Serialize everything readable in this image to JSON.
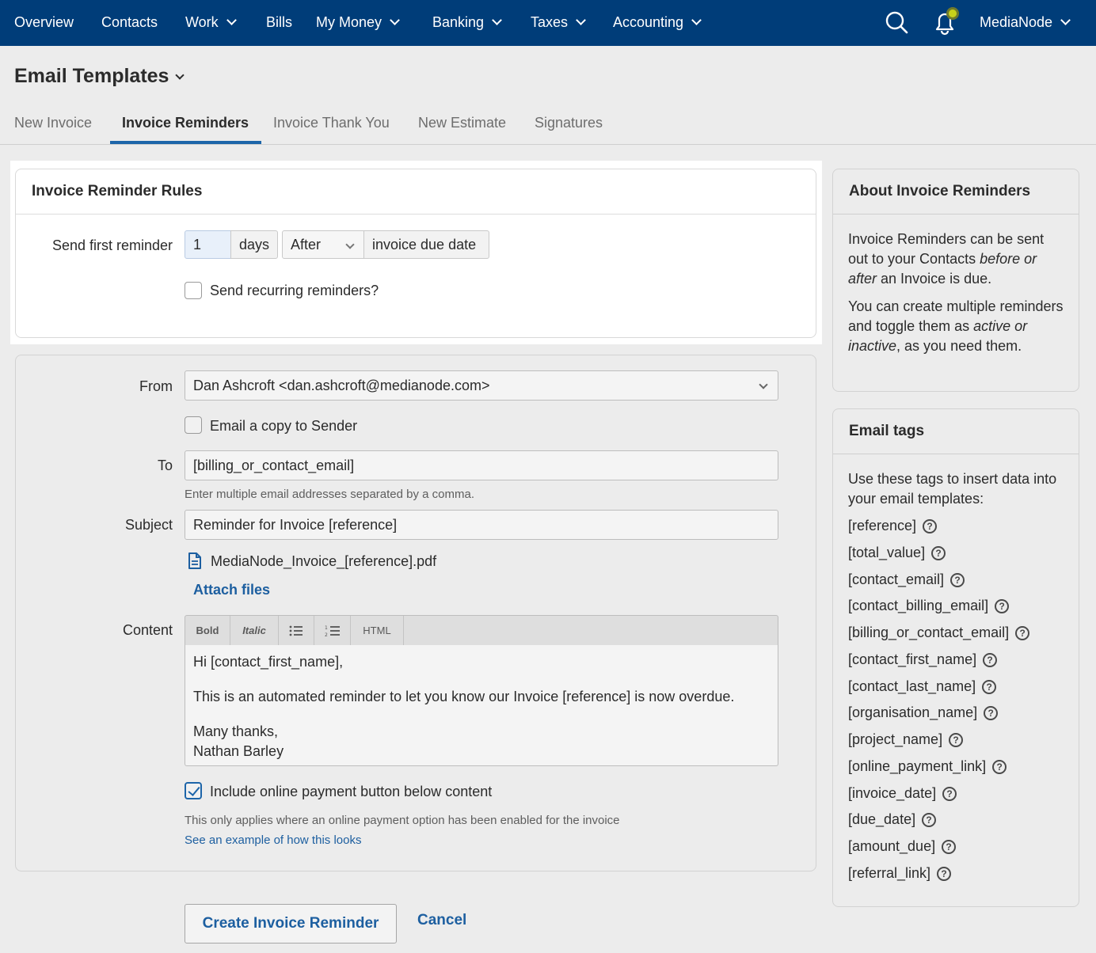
{
  "nav": {
    "items": [
      {
        "label": "Overview",
        "dropdown": false
      },
      {
        "label": "Contacts",
        "dropdown": false
      },
      {
        "label": "Work",
        "dropdown": true
      },
      {
        "label": "Bills",
        "dropdown": false
      },
      {
        "label": "My Money",
        "dropdown": true
      },
      {
        "label": "Banking",
        "dropdown": true
      },
      {
        "label": "Taxes",
        "dropdown": true
      },
      {
        "label": "Accounting",
        "dropdown": true
      }
    ],
    "account_label": "MediaNode",
    "colors": {
      "bar": "#003d79",
      "notification_dot": "#c8d21a"
    }
  },
  "page": {
    "title": "Email Templates",
    "tabs": [
      "New Invoice",
      "Invoice Reminders",
      "Invoice Thank You",
      "New Estimate",
      "Signatures"
    ],
    "active_tab": "Invoice Reminders"
  },
  "rules": {
    "header": "Invoice Reminder Rules",
    "send_first_label": "Send first reminder",
    "days_value": "1",
    "days_unit": "days",
    "timing_selected": "After",
    "suffix": "invoice due date",
    "recurring_label": "Send recurring reminders?",
    "recurring_checked": false
  },
  "email": {
    "from_label": "From",
    "from_value": "Dan Ashcroft <dan.ashcroft@medianode.com>",
    "copy_label": "Email a copy to Sender",
    "copy_checked": false,
    "to_label": "To",
    "to_value": "[billing_or_contact_email]",
    "to_hint": "Enter multiple email addresses separated by a comma.",
    "subject_label": "Subject",
    "subject_value": "Reminder for Invoice [reference]",
    "attachment_name": "MediaNode_Invoice_[reference].pdf",
    "attach_link": "Attach files",
    "content_label": "Content",
    "toolbar": {
      "bold": "Bold",
      "italic": "Italic",
      "html": "HTML"
    },
    "content": {
      "greeting": "Hi [contact_first_name],",
      "body": "This is an automated reminder to let you know our Invoice [reference] is now overdue.",
      "signoff": "Many thanks,",
      "name": "Nathan Barley"
    },
    "payment_label": "Include online payment button below content",
    "payment_checked": true,
    "payment_hint": "This only applies where an online payment option has been enabled for the invoice",
    "example_link": "See an example of how this looks"
  },
  "about": {
    "header": "About Invoice Reminders",
    "p1_a": "Invoice Reminders can be sent out to your Contacts ",
    "p1_em": "before or after",
    "p1_b": " an Invoice is due.",
    "p2_a": "You can create multiple reminders and toggle them as ",
    "p2_em": "active or inactive",
    "p2_b": ", as you need them."
  },
  "tags": {
    "header": "Email tags",
    "intro": "Use these tags to insert data into your email templates:",
    "items": [
      "[reference]",
      "[total_value]",
      "[contact_email]",
      "[contact_billing_email]",
      "[billing_or_contact_email]",
      "[contact_first_name]",
      "[contact_last_name]",
      "[organisation_name]",
      "[project_name]",
      "[online_payment_link]",
      "[invoice_date]",
      "[due_date]",
      "[amount_due]",
      "[referral_link]"
    ]
  },
  "actions": {
    "create": "Create Invoice Reminder",
    "cancel": "Cancel"
  }
}
